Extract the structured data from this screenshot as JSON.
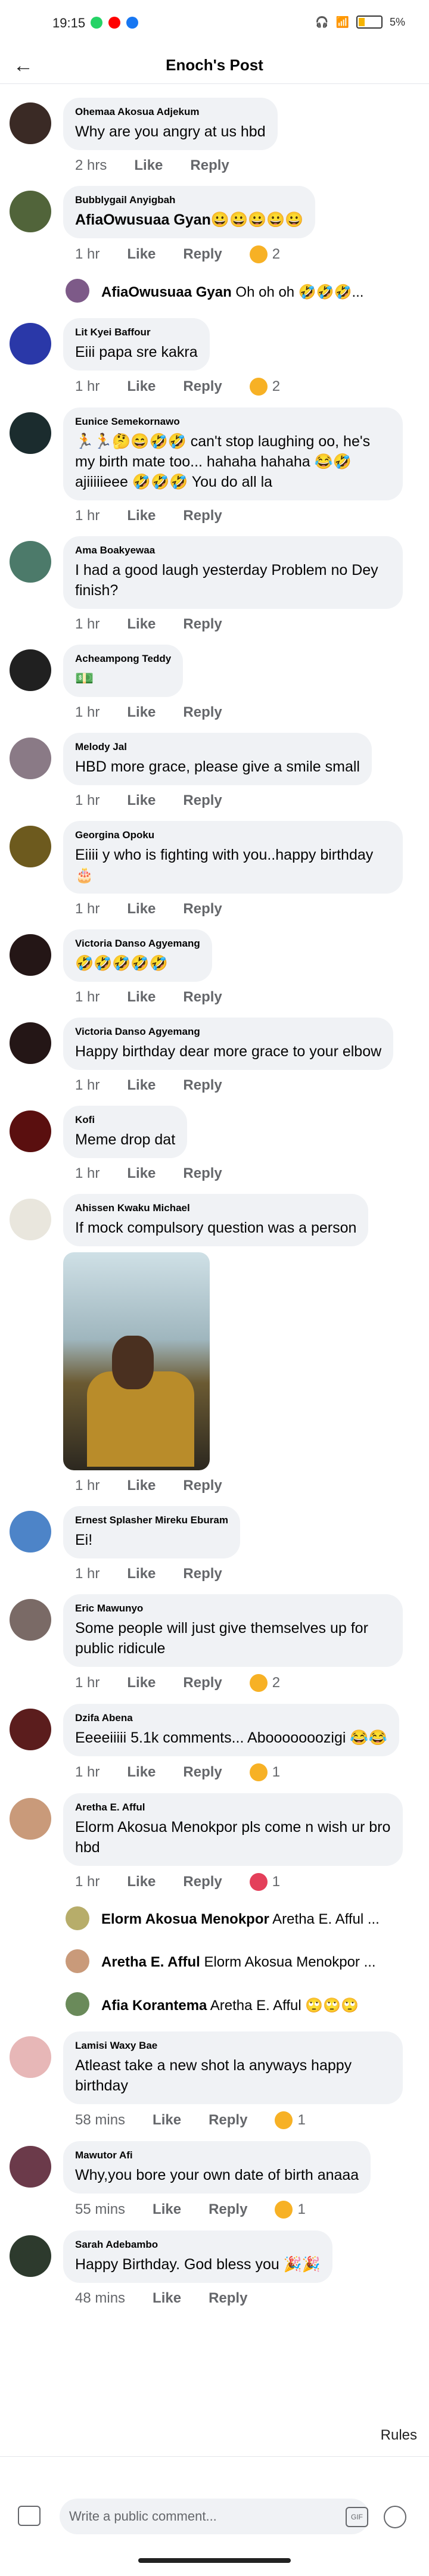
{
  "status": {
    "time": "19:15",
    "battery": "5%"
  },
  "header": {
    "title": "Enoch's Post",
    "back_icon": "←"
  },
  "comments": [
    {
      "author": "Ohemaa Akosua Adjekum",
      "text": "Why are you angry at us hbd",
      "time": "2 hrs",
      "like": "Like",
      "reply": "Reply"
    },
    {
      "author": "Bubblygail Anyigbah",
      "text": "AfiaOwusuaa Gyan😀😀😀😀😀",
      "time": "1 hr",
      "like": "Like",
      "reply": "Reply",
      "reaction": "2"
    },
    {
      "type": "reply",
      "author": "AfiaOwusuaa Gyan",
      "text": "Oh oh oh 🤣🤣🤣..."
    },
    {
      "author": "Lit Kyei Baffour",
      "text": "Eiii papa sre kakra",
      "time": "1 hr",
      "like": "Like",
      "reply": "Reply",
      "reaction": "2"
    },
    {
      "author": "Eunice Semekornawo",
      "text": "🏃🏃🤔😄🤣🤣 can't stop laughing oo, he's my birth mate too... hahaha hahaha 😂🤣 ajiiiiieee 🤣🤣🤣 You do all la",
      "time": "1 hr",
      "like": "Like",
      "reply": "Reply"
    },
    {
      "author": "Ama Boakyewaa",
      "text": "I had a good laugh yesterday Problem no Dey finish?",
      "time": "1 hr",
      "like": "Like",
      "reply": "Reply"
    },
    {
      "author": "Acheampong Teddy",
      "text": "💵",
      "time": "1 hr",
      "like": "Like",
      "reply": "Reply"
    },
    {
      "author": "Melody Jal",
      "text": "HBD more grace, please give a smile small",
      "time": "1 hr",
      "like": "Like",
      "reply": "Reply"
    },
    {
      "author": "Georgina Opoku",
      "text": "Eiiii y who is fighting with you..happy birthday 🎂",
      "time": "1 hr",
      "like": "Like",
      "reply": "Reply"
    },
    {
      "author": "Victoria Danso Agyemang",
      "text": "🤣🤣🤣🤣🤣",
      "time": "1 hr",
      "like": "Like",
      "reply": "Reply"
    },
    {
      "author": "Victoria Danso Agyemang",
      "text": "Happy birthday dear more grace to your elbow",
      "time": "1 hr",
      "like": "Like",
      "reply": "Reply"
    },
    {
      "author": "Kofi",
      "text": "Meme drop dat",
      "time": "1 hr",
      "like": "Like",
      "reply": "Reply"
    },
    {
      "author": "Ahissen Kwaku Michael",
      "text": "If mock compulsory question was a person",
      "time": "1 hr",
      "like": "Like",
      "reply": "Reply",
      "photo": true
    },
    {
      "author": "Ernest Splasher Mireku Eburam",
      "text": "Ei!",
      "time": "1 hr",
      "like": "Like",
      "reply": "Reply"
    },
    {
      "author": "Eric Mawunyo",
      "text": "Some people will just give themselves up for public ridicule",
      "time": "1 hr",
      "like": "Like",
      "reply": "Reply",
      "reaction": "2"
    },
    {
      "author": "Dzifa Abena",
      "text": "Eeeeiiiii 5.1k comments... Abooooooozigi 😂😂",
      "time": "1 hr",
      "like": "Like",
      "reply": "Reply",
      "reaction": "1"
    },
    {
      "author": "Aretha E. Afful",
      "text": "Elorm Akosua Menokpor pls come n wish ur bro hbd",
      "time": "1 hr",
      "like": "Like",
      "reply": "Reply",
      "reaction": "1",
      "heart": true
    },
    {
      "type": "reply",
      "author": "Elorm Akosua Menokpor",
      "text": "Aretha E. Afful ..."
    },
    {
      "type": "reply",
      "author": "Aretha E. Afful",
      "text": "Elorm Akosua Menokpor ..."
    },
    {
      "type": "reply",
      "author": "Afia Korantema",
      "text": "Aretha E. Afful 🙄🙄🙄"
    },
    {
      "author": "Lamisi Waxy Bae",
      "text": "Atleast take a new shot la anyways happy birthday",
      "time": "58 mins",
      "like": "Like",
      "reply": "Reply",
      "reaction": "1"
    },
    {
      "author": "Mawutor Afi",
      "text": "Why,you bore your own date of birth anaaa",
      "time": "55 mins",
      "like": "Like",
      "reply": "Reply",
      "reaction": "1"
    },
    {
      "author": "Sarah Adebambo",
      "text": "Happy Birthday. God bless you 🎉🎉",
      "time": "48 mins",
      "like": "Like",
      "reply": "Reply"
    }
  ],
  "footer": {
    "rules": "Rules",
    "placeholder": "Write a public comment...",
    "gif": "GIF"
  }
}
